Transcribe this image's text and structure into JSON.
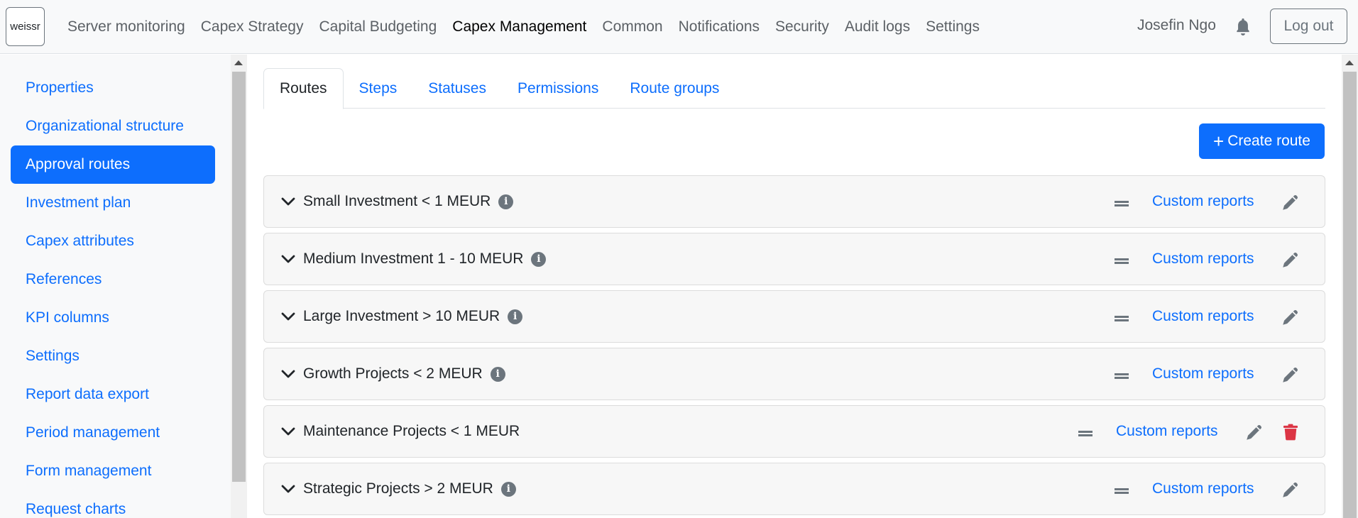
{
  "header": {
    "logo_text": "weissr",
    "nav": [
      {
        "label": "Server monitoring",
        "active": false
      },
      {
        "label": "Capex Strategy",
        "active": false
      },
      {
        "label": "Capital Budgeting",
        "active": false
      },
      {
        "label": "Capex Management",
        "active": true
      },
      {
        "label": "Common",
        "active": false
      },
      {
        "label": "Notifications",
        "active": false
      },
      {
        "label": "Security",
        "active": false
      },
      {
        "label": "Audit logs",
        "active": false
      },
      {
        "label": "Settings",
        "active": false
      }
    ],
    "user_name": "Josefin Ngo",
    "bell_icon": "bell-icon",
    "logout_label": "Log out"
  },
  "sidebar": {
    "items": [
      {
        "label": "Properties",
        "active": false
      },
      {
        "label": "Organizational structure",
        "active": false
      },
      {
        "label": "Approval routes",
        "active": true
      },
      {
        "label": "Investment plan",
        "active": false
      },
      {
        "label": "Capex attributes",
        "active": false
      },
      {
        "label": "References",
        "active": false
      },
      {
        "label": "KPI columns",
        "active": false
      },
      {
        "label": "Settings",
        "active": false
      },
      {
        "label": "Report data export",
        "active": false
      },
      {
        "label": "Period management",
        "active": false
      },
      {
        "label": "Form management",
        "active": false
      },
      {
        "label": "Request charts",
        "active": false
      }
    ]
  },
  "main": {
    "tabs": [
      {
        "label": "Routes",
        "active": true
      },
      {
        "label": "Steps",
        "active": false
      },
      {
        "label": "Statuses",
        "active": false
      },
      {
        "label": "Permissions",
        "active": false
      },
      {
        "label": "Route groups",
        "active": false
      }
    ],
    "create_button": {
      "plus": "+",
      "label": "Create route"
    },
    "routes": [
      {
        "name": "Small Investment < 1 MEUR",
        "has_info": true,
        "reports_label": "Custom reports",
        "deletable": false
      },
      {
        "name": "Medium Investment 1 - 10 MEUR",
        "has_info": true,
        "reports_label": "Custom reports",
        "deletable": false
      },
      {
        "name": "Large Investment > 10 MEUR",
        "has_info": true,
        "reports_label": "Custom reports",
        "deletable": false
      },
      {
        "name": "Growth Projects < 2 MEUR",
        "has_info": true,
        "reports_label": "Custom reports",
        "deletable": false
      },
      {
        "name": "Maintenance Projects < 1 MEUR",
        "has_info": false,
        "reports_label": "Custom reports",
        "deletable": true
      },
      {
        "name": "Strategic Projects > 2 MEUR",
        "has_info": true,
        "reports_label": "Custom reports",
        "deletable": false
      }
    ],
    "info_glyph": "i"
  },
  "colors": {
    "primary": "#0d6efd",
    "danger": "#dc3545",
    "muted": "#6c757d",
    "navbar_bg": "#f8f9fa"
  }
}
